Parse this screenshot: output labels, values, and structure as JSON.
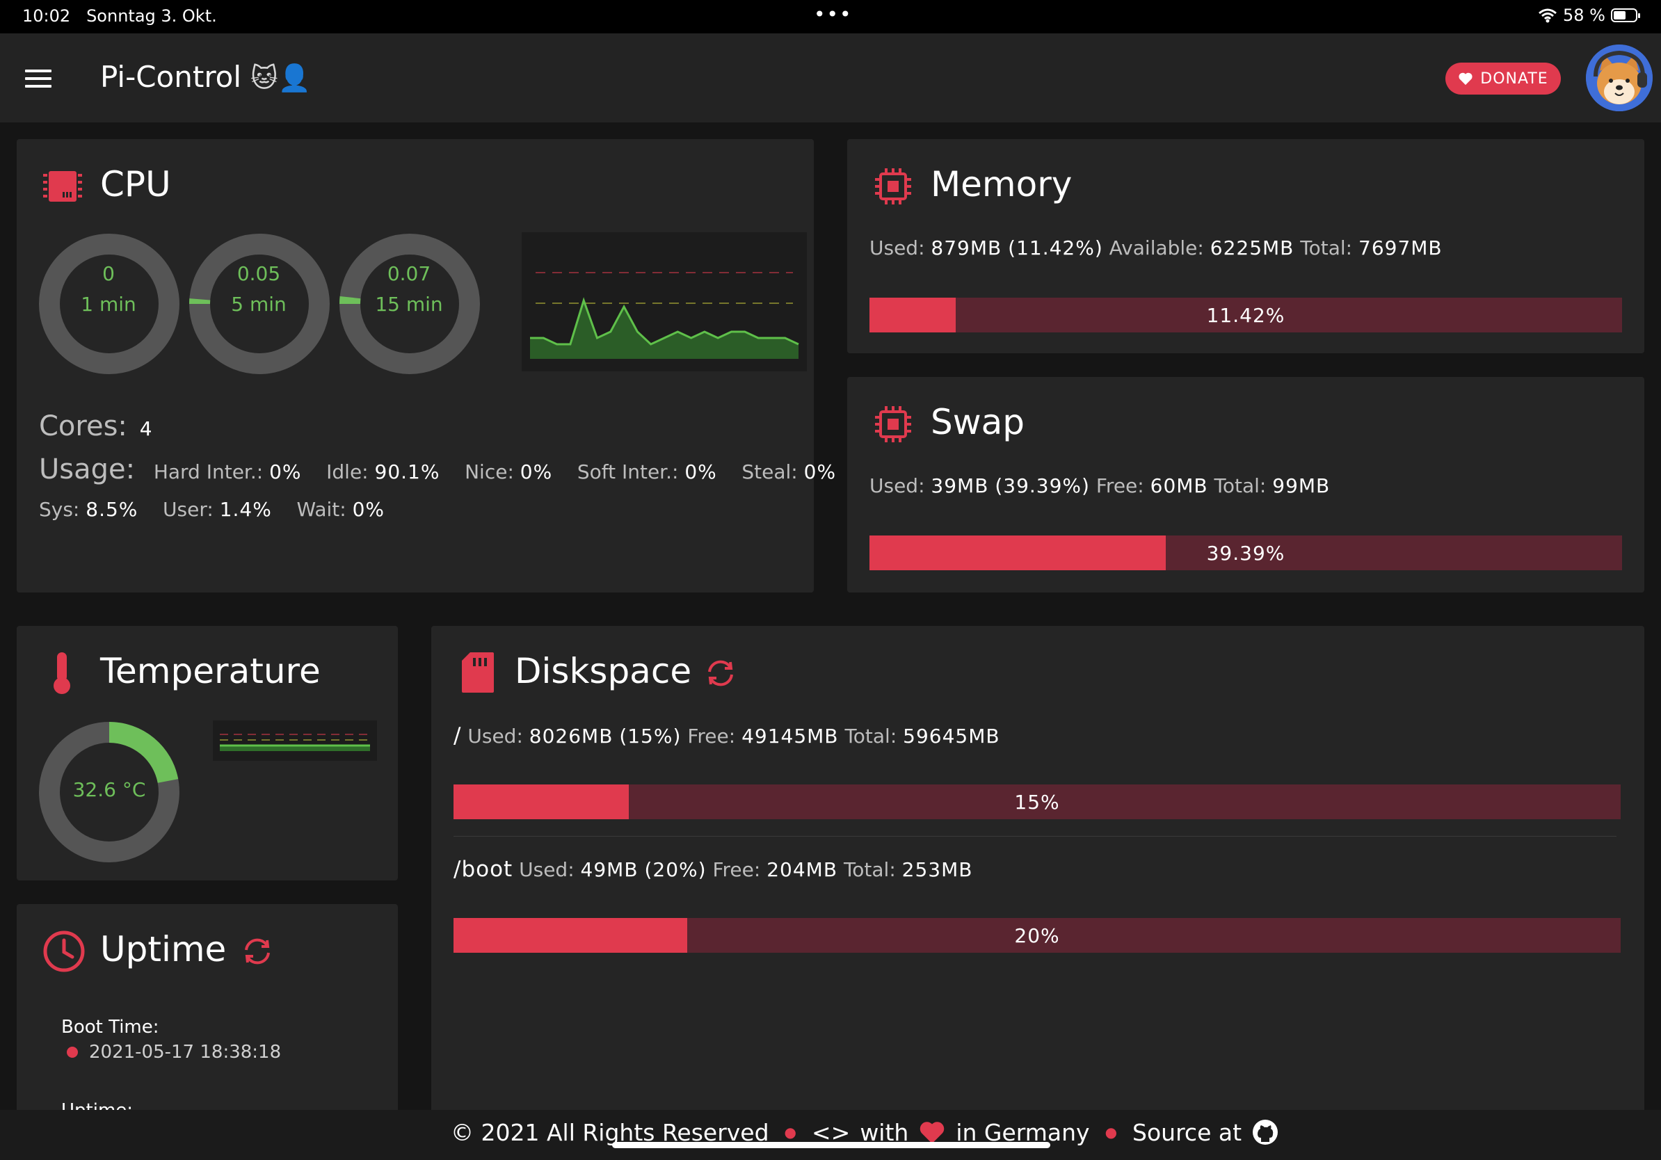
{
  "status_bar": {
    "time": "10:02",
    "date": "Sonntag 3. Okt.",
    "battery_text": "58 %",
    "battery_level": 0.58
  },
  "app": {
    "title": "Pi-Control",
    "title_emoji": "🐱👤",
    "donate_label": "DONATE"
  },
  "cpu": {
    "title": "CPU",
    "loads": [
      {
        "value": "0",
        "period": "1 min",
        "fraction": 0
      },
      {
        "value": "0.05",
        "period": "5 min",
        "fraction": 0.0125
      },
      {
        "value": "0.07",
        "period": "15 min",
        "fraction": 0.0175
      }
    ],
    "history": [
      2,
      2,
      1,
      1,
      8,
      2,
      3,
      7,
      3,
      1,
      2,
      3,
      2,
      3,
      2,
      3,
      3,
      2,
      2,
      2,
      1
    ],
    "cores_label": "Cores:",
    "cores_value": "4",
    "usage_label": "Usage:",
    "usage": [
      {
        "label": "Hard Inter.:",
        "value": "0%"
      },
      {
        "label": "Idle:",
        "value": "90.1%"
      },
      {
        "label": "Nice:",
        "value": "0%"
      },
      {
        "label": "Soft Inter.:",
        "value": "0%"
      },
      {
        "label": "Steal:",
        "value": "0%"
      },
      {
        "label": "Sys:",
        "value": "8.5%"
      },
      {
        "label": "User:",
        "value": "1.4%"
      },
      {
        "label": "Wait:",
        "value": "0%"
      }
    ]
  },
  "memory": {
    "title": "Memory",
    "used_label": "Used:",
    "used": "879MB",
    "used_pct_text": "(11.42%)",
    "available_label": "Available:",
    "available": "6225MB",
    "total_label": "Total:",
    "total": "7697MB",
    "bar_text": "11.42%",
    "fraction": 0.1142
  },
  "swap": {
    "title": "Swap",
    "used_label": "Used:",
    "used": "39MB",
    "used_pct_text": "(39.39%)",
    "free_label": "Free:",
    "free": "60MB",
    "total_label": "Total:",
    "total": "99MB",
    "bar_text": "39.39%",
    "fraction": 0.3939
  },
  "temperature": {
    "title": "Temperature",
    "value_text": "32.6 °C",
    "fraction": 0.22
  },
  "diskspace": {
    "title": "Diskspace",
    "disks": [
      {
        "mount": "/",
        "used_label": "Used:",
        "used": "8026MB",
        "pct_text": "(15%)",
        "free_label": "Free:",
        "free": "49145MB",
        "total_label": "Total:",
        "total": "59645MB",
        "bar_text": "15%",
        "fraction": 0.15
      },
      {
        "mount": "/boot",
        "used_label": "Used:",
        "used": "49MB",
        "pct_text": "(20%)",
        "free_label": "Free:",
        "free": "204MB",
        "total_label": "Total:",
        "total": "253MB",
        "bar_text": "20%",
        "fraction": 0.2
      }
    ]
  },
  "uptime": {
    "title": "Uptime",
    "boot_time_label": "Boot Time:",
    "boot_time": "2021-05-17 18:38:18",
    "uptime_label": "Uptime:"
  },
  "footer": {
    "copyright": "© 2021 All Rights Reserved",
    "code_glyph": "<>",
    "with_text": "with",
    "country_text": "in Germany",
    "source_text": "Source at"
  },
  "colors": {
    "accent": "#e03a4e",
    "bar_track": "#5a2530",
    "green": "#6ebf5a",
    "card": "#252525",
    "background": "#151515"
  }
}
